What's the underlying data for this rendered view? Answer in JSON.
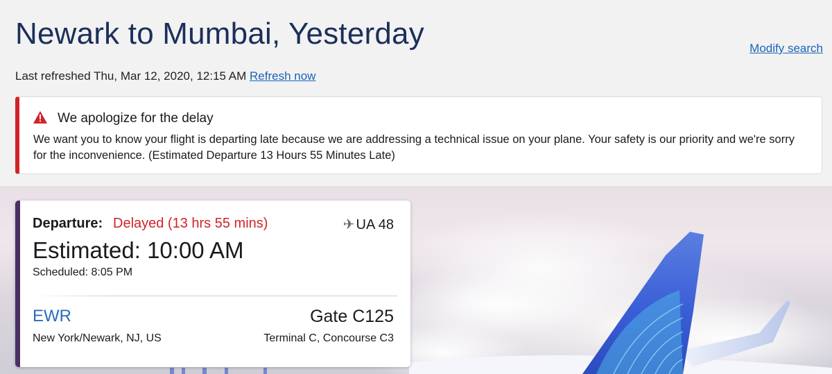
{
  "header": {
    "title": "Newark to Mumbai, Yesterday",
    "modify_search": "Modify search",
    "last_refreshed": "Last refreshed Thu, Mar 12, 2020, 12:15 AM",
    "refresh_now": "Refresh now"
  },
  "alert": {
    "icon": "warning-icon",
    "title": "We apologize for the delay",
    "body": "We want you to know your flight is departing late because we are addressing a technical issue on your plane. Your safety is our priority and we're sorry for the inconvenience. (Estimated Departure 13 Hours 55 Minutes Late)",
    "color": "#d0232a"
  },
  "flight_card": {
    "departure_label": "Departure:",
    "status": "Delayed (13 hrs 55 mins)",
    "plane_icon": "airplane-icon",
    "flight_number": "UA 48",
    "estimated": "Estimated: 10:00 AM",
    "scheduled": "Scheduled: 8:05 PM",
    "airport_code": "EWR",
    "city": "New York/Newark, NJ, US",
    "gate": "Gate C125",
    "terminal": "Terminal C, Concourse C3",
    "accent_color": "#4a2f63",
    "status_color": "#d0232a",
    "link_color": "#2a6cb8"
  }
}
